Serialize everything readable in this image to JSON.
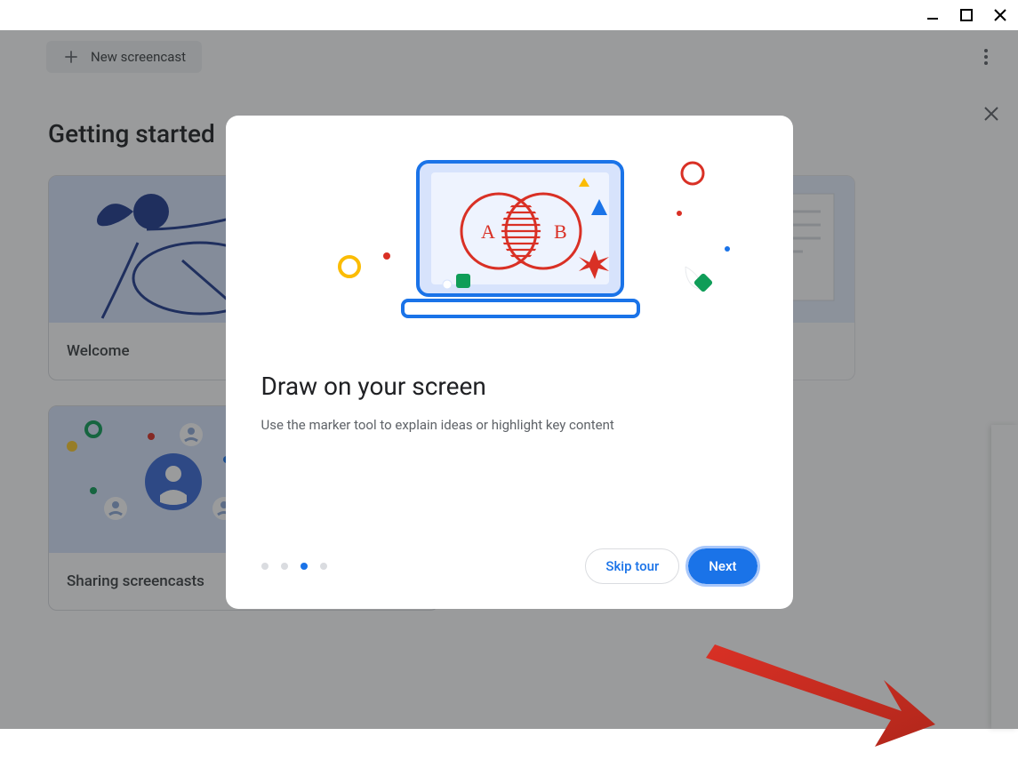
{
  "window": {
    "minimize_icon": "minimize",
    "maximize_icon": "maximize",
    "close_icon": "close"
  },
  "toolbar": {
    "new_screencast_label": "New screencast"
  },
  "page": {
    "heading": "Getting started"
  },
  "cards": [
    {
      "title": "Welcome"
    },
    {
      "title": ""
    },
    {
      "title": "Sharing screencasts"
    }
  ],
  "dialog": {
    "title": "Draw on your screen",
    "body": "Use the marker tool to explain ideas or highlight key content",
    "venn_a": "A",
    "venn_b": "B",
    "step_count": 4,
    "active_step": 3,
    "skip_label": "Skip tour",
    "next_label": "Next"
  }
}
